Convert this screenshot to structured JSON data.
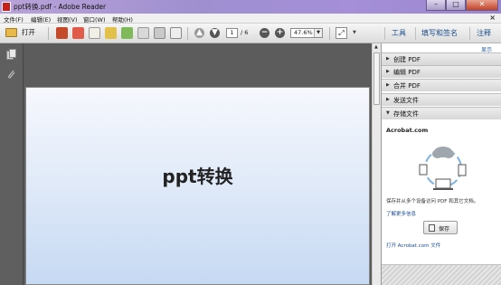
{
  "window": {
    "title": "ppt转换.pdf - Adobe Reader",
    "minimize": "–",
    "maximize": "□",
    "close": "✕"
  },
  "menu": {
    "items": [
      "文件(F)",
      "编辑(E)",
      "视图(V)",
      "窗口(W)",
      "帮助(H)"
    ],
    "close_glyph": "×"
  },
  "toolbar": {
    "open_label": "打开",
    "page_current": "1",
    "page_total": "/ 6",
    "zoom": "47.6%",
    "zoom_out": "−",
    "zoom_in": "+",
    "tabs": [
      "工具",
      "填写和签名",
      "注释"
    ],
    "accent": "#1a4d8a"
  },
  "document": {
    "slide_title": "ppt转换"
  },
  "right_panel": {
    "show_link": "显示",
    "sections": [
      {
        "label": "创建 PDF",
        "expanded": false
      },
      {
        "label": "编辑 PDF",
        "expanded": false
      },
      {
        "label": "合并 PDF",
        "expanded": false
      },
      {
        "label": "发送文件",
        "expanded": false
      },
      {
        "label": "存储文件",
        "expanded": true
      }
    ],
    "acrobat_title": "Acrobat.com",
    "description": "保存并从多个设备访问 PDF 和其它文档。",
    "more_link": "了解更多信息",
    "save_button": "保存",
    "open_link": "打开 Acrobat.com 文件"
  }
}
